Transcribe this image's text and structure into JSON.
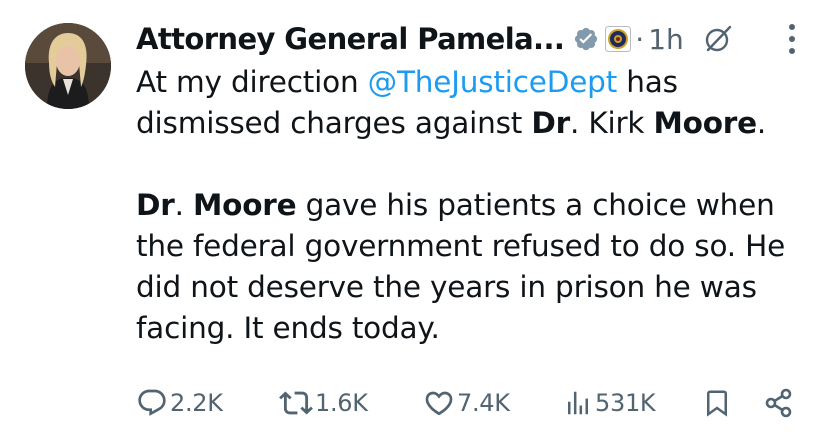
{
  "author": {
    "name": "Attorney General Pamela...",
    "time": "1h",
    "separator": "·"
  },
  "tweet": {
    "line1_pre": "At my direction ",
    "mention": "@TheJusticeDept",
    "line1_post": " has",
    "line2_pre": "dismissed charges against ",
    "line2_b1": "Dr",
    "line2_mid": ". Kirk ",
    "line2_b2": "Moore",
    "line2_end": ".",
    "p2_b1": "Dr",
    "p2_mid": ". ",
    "p2_b2": "Moore",
    "p2_rest1": " gave his patients a choice when",
    "p2_line2": "the federal government refused to do so. He",
    "p2_line3": "did not deserve the years in prison he was",
    "p2_line4": "facing. It ends today."
  },
  "stats": {
    "replies": "2.2K",
    "reposts": "1.6K",
    "likes": "7.4K",
    "views": "531K"
  },
  "icons": {
    "verified": "verified-badge-icon",
    "affiliate": "doj-seal-icon",
    "grok": "grok-icon",
    "more": "more-icon",
    "reply": "reply-icon",
    "repost": "repost-icon",
    "like": "heart-icon",
    "views": "views-icon",
    "bookmark": "bookmark-icon",
    "share": "share-icon"
  },
  "colors": {
    "text": "#0f1419",
    "secondary": "#536471",
    "link": "#1d9bf0"
  }
}
